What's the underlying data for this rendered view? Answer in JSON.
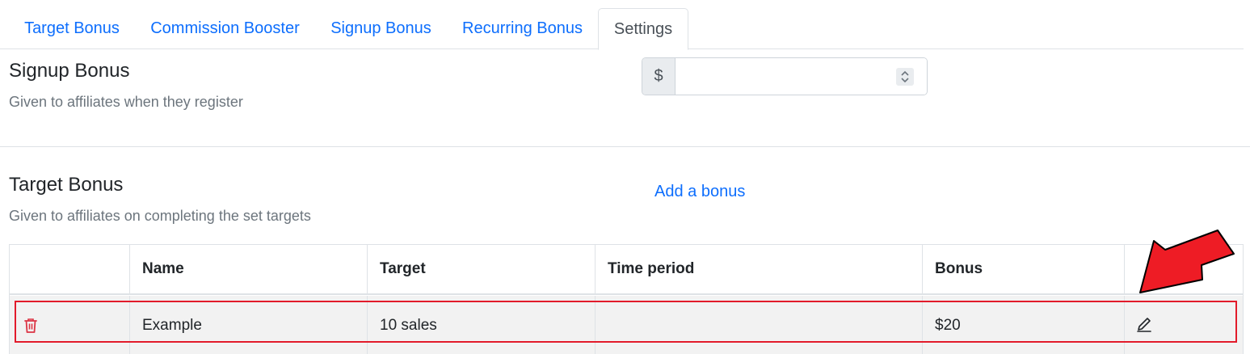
{
  "tabs": [
    {
      "label": "Target Bonus"
    },
    {
      "label": "Commission Booster"
    },
    {
      "label": "Signup Bonus"
    },
    {
      "label": "Recurring Bonus"
    },
    {
      "label": "Settings"
    }
  ],
  "signup": {
    "title": "Signup Bonus",
    "description": "Given to affiliates when they register",
    "currency_symbol": "$",
    "amount_value": ""
  },
  "target": {
    "title": "Target Bonus",
    "description": "Given to affiliates on completing the set targets",
    "add_link": "Add a bonus"
  },
  "table": {
    "headers": [
      "",
      "Name",
      "Target",
      "Time period",
      "Bonus",
      ""
    ],
    "rows": [
      {
        "name": "Example",
        "target": "10 sales",
        "time_period": "",
        "bonus": "$20"
      }
    ]
  },
  "icons": {
    "delete": "trash-icon",
    "edit": "pencil-icon",
    "annotation": "red-arrow-icon"
  },
  "colors": {
    "link": "#0d6efd",
    "danger": "#dc3545",
    "annotation": "#e21b2b",
    "muted": "#6c757d"
  }
}
